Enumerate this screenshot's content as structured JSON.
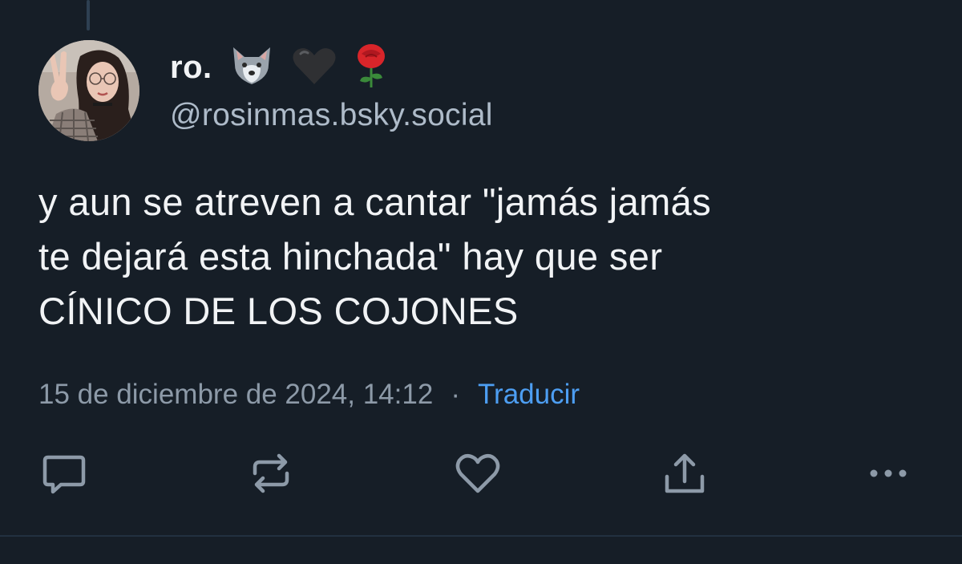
{
  "author": {
    "display_name": "ro.",
    "emoji_icons": [
      "wolf-icon",
      "black-heart-icon",
      "rose-icon"
    ],
    "handle": "@rosinmas.bsky.social"
  },
  "post": {
    "text": "y aun se atreven a cantar \"jamás jamás\nte dejará esta hinchada\" hay que ser\nCÍNICO DE LOS COJONES",
    "timestamp": "15 de diciembre de 2024, 14:12",
    "separator": "·",
    "translate_label": "Traducir"
  },
  "actions": [
    "reply-icon",
    "repost-icon",
    "like-icon",
    "share-icon",
    "more-options-icon"
  ],
  "colors": {
    "background": "#161e27",
    "text": "#f1f3f5",
    "muted": "#8d9aa8",
    "accent": "#4d9ef2"
  }
}
